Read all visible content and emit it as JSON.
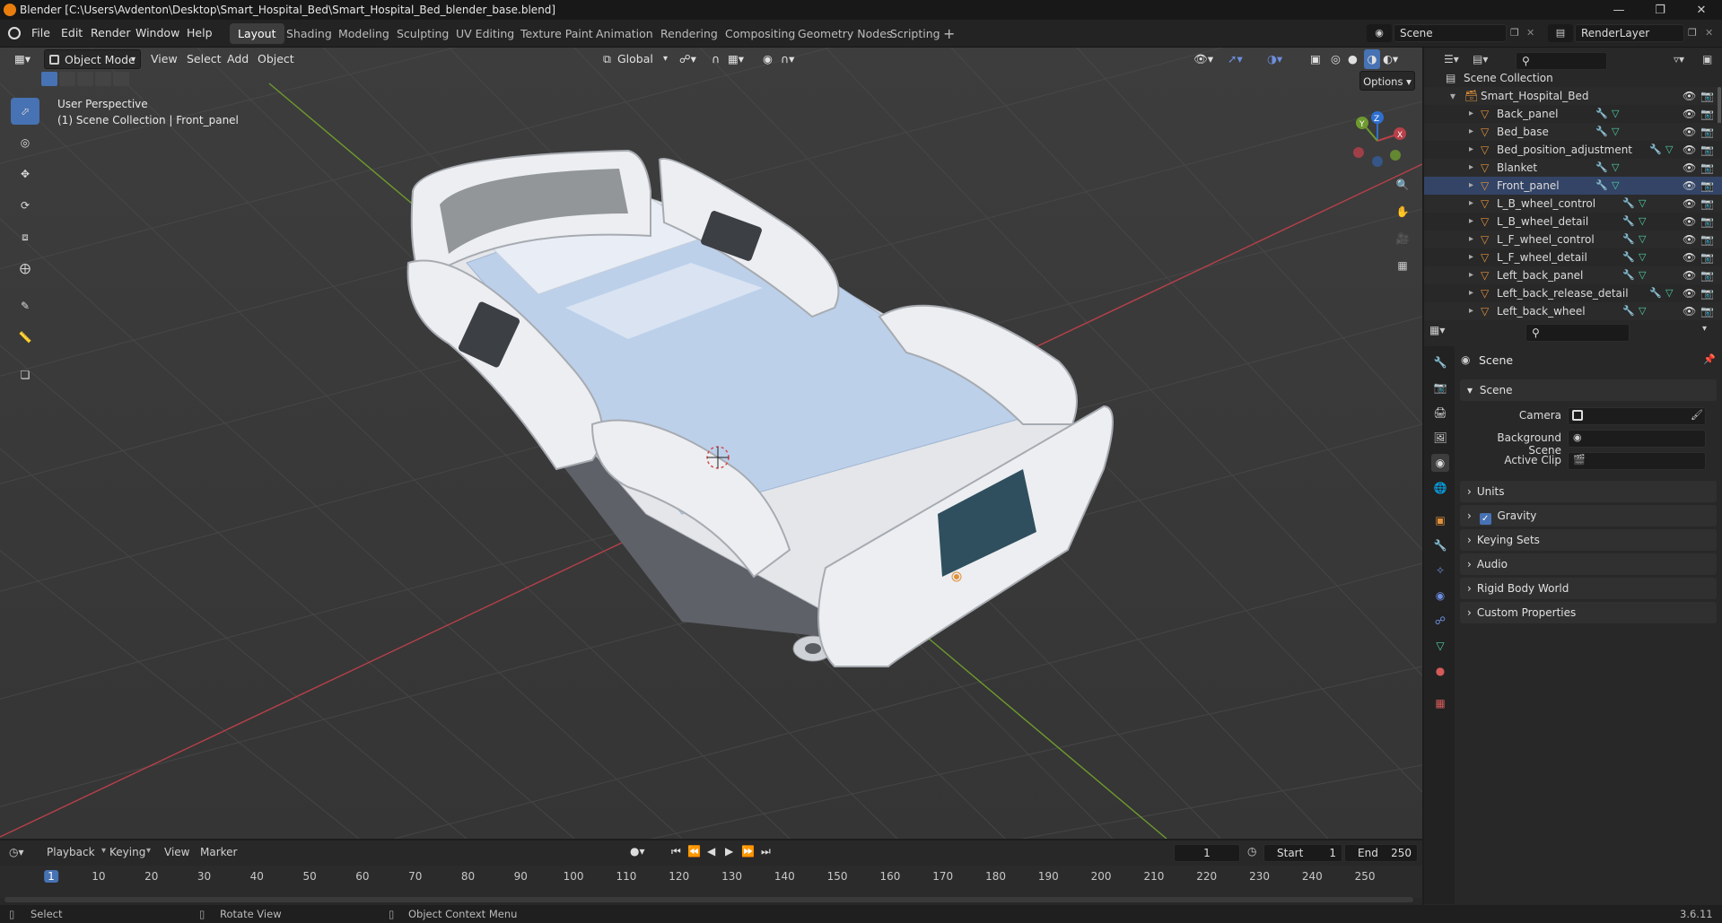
{
  "window": {
    "title": "Blender [C:\\Users\\Avdenton\\Desktop\\Smart_Hospital_Bed\\Smart_Hospital_Bed_blender_base.blend]"
  },
  "menu": [
    "File",
    "Edit",
    "Render",
    "Window",
    "Help"
  ],
  "workspaces": [
    "Layout",
    "Shading",
    "Modeling",
    "Sculpting",
    "UV Editing",
    "Texture Paint",
    "Animation",
    "Rendering",
    "Compositing",
    "Geometry Nodes",
    "Scripting"
  ],
  "active_workspace": "Layout",
  "scene_name": "Scene",
  "view_layer": "RenderLayer",
  "viewport": {
    "mode": "Object Mode",
    "menus": [
      "View",
      "Select",
      "Add",
      "Object"
    ],
    "transform_orientation": "Global",
    "options_label": "Options",
    "perspective": "User Perspective",
    "collection_info": "(1) Scene Collection | Front_panel",
    "gizmo": {
      "x": "X",
      "y": "Y",
      "z": "Z"
    }
  },
  "outliner": {
    "root": "Scene Collection",
    "collection": "Smart_Hospital_Bed",
    "objects": [
      "Back_panel",
      "Bed_base",
      "Bed_position_adjustment",
      "Blanket",
      "Front_panel",
      "L_B_wheel_control",
      "L_B_wheel_detail",
      "L_F_wheel_control",
      "L_F_wheel_detail",
      "Left_back_panel",
      "Left_back_release_detail",
      "Left_back_wheel"
    ],
    "selected": "Front_panel"
  },
  "properties": {
    "context_title": "Scene",
    "section_scene": "Scene",
    "fields": [
      {
        "label": "Camera"
      },
      {
        "label": "Background Scene"
      },
      {
        "label": "Active Clip"
      }
    ],
    "collapsed_sections": [
      "Units",
      "Gravity",
      "Keying Sets",
      "Audio",
      "Rigid Body World",
      "Custom Properties"
    ],
    "gravity_checked": true
  },
  "timeline": {
    "menus": [
      "Playback",
      "Keying",
      "View",
      "Marker"
    ],
    "current_frame": "1",
    "start_label": "Start",
    "start": "1",
    "end_label": "End",
    "end": "250",
    "ticks": [
      "1",
      "10",
      "20",
      "30",
      "40",
      "50",
      "60",
      "70",
      "80",
      "90",
      "100",
      "110",
      "120",
      "130",
      "140",
      "150",
      "160",
      "170",
      "180",
      "190",
      "200",
      "210",
      "220",
      "230",
      "240",
      "250"
    ]
  },
  "statusbar": {
    "select": "Select",
    "rotate": "Rotate View",
    "context_menu": "Object Context Menu",
    "version": "3.6.11"
  },
  "colors": {
    "accent": "#4772b3",
    "x_axis": "#b8404a",
    "y_axis": "#6e9a2e",
    "z_axis": "#2e6fd0",
    "object_icon": "#e0913a",
    "modifier_icon": "#6d8fe0",
    "mesh_icon": "#4fd1a5"
  }
}
